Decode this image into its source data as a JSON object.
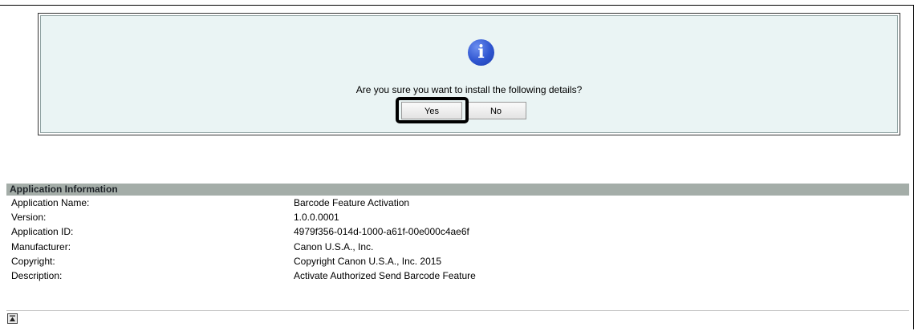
{
  "confirm": {
    "icon": "info-icon",
    "icon_glyph": "i",
    "question": "Are you sure you want to install the following details?",
    "yes_label": "Yes",
    "no_label": "No"
  },
  "app_info": {
    "header": "Application Information",
    "rows": [
      {
        "label": "Application Name:",
        "value": "Barcode Feature Activation"
      },
      {
        "label": "Version:",
        "value": "1.0.0.0001"
      },
      {
        "label": "Application ID:",
        "value": "4979f356-014d-1000-a61f-00e000c4ae6f"
      },
      {
        "label": "Manufacturer:",
        "value": "Canon U.S.A., Inc."
      },
      {
        "label": "Copyright:",
        "value": "Copyright Canon U.S.A., Inc. 2015"
      },
      {
        "label": "Description:",
        "value": "Activate Authorized Send Barcode Feature"
      }
    ]
  },
  "footer": {
    "top_icon": "scroll-to-top-icon"
  }
}
